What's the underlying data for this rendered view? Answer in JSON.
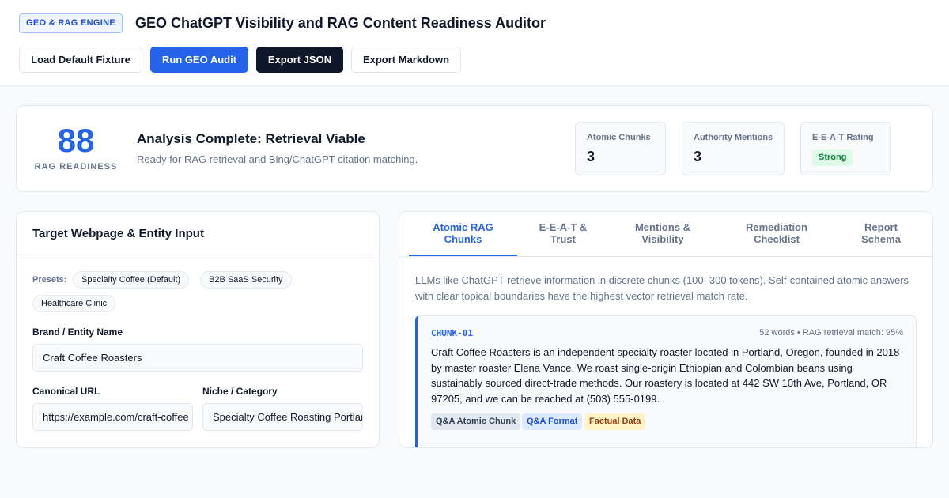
{
  "header": {
    "badge": "GEO & RAG ENGINE",
    "title": "GEO ChatGPT Visibility and RAG Content Readiness Auditor",
    "buttons": {
      "load": "Load Default Fixture",
      "run": "Run GEO Audit",
      "export_json": "Export JSON",
      "export_md": "Export Markdown"
    }
  },
  "summary": {
    "score": "88",
    "score_label": "RAG READINESS",
    "status_title": "Analysis Complete: Retrieval Viable",
    "status_desc": "Ready for RAG retrieval and Bing/ChatGPT citation matching.",
    "metrics": [
      {
        "label": "Atomic Chunks",
        "value": "3"
      },
      {
        "label": "Authority Mentions",
        "value": "3"
      },
      {
        "label": "E-E-A-T Rating",
        "value": "Strong"
      }
    ]
  },
  "input_panel": {
    "title": "Target Webpage & Entity Input",
    "presets_label": "Presets:",
    "presets": [
      "Specialty Coffee (Default)",
      "B2B SaaS Security",
      "Healthcare Clinic"
    ],
    "brand_label": "Brand / Entity Name",
    "brand_value": "Craft Coffee Roasters",
    "url_label": "Canonical URL",
    "url_value": "https://example.com/craft-coffee",
    "niche_label": "Niche / Category",
    "niche_value": "Specialty Coffee Roasting Portland"
  },
  "results_panel": {
    "tabs": [
      {
        "line1": "Atomic RAG",
        "line2": "Chunks"
      },
      {
        "line1": "E-E-A-T &",
        "line2": "Trust"
      },
      {
        "line1": "Mentions &",
        "line2": "Visibility"
      },
      {
        "line1": "Remediation",
        "line2": "Checklist"
      },
      {
        "line1": "Report",
        "line2": "Schema"
      }
    ],
    "intro": "LLMs like ChatGPT retrieve information in discrete chunks (100–300 tokens). Self-contained atomic answers with clear topical boundaries have the highest vector retrieval match rate.",
    "chunk": {
      "id": "CHUNK-01",
      "meta": "52 words • RAG retrieval match: 95%",
      "text": "Craft Coffee Roasters is an independent specialty roaster located in Portland, Oregon, founded in 2018 by master roaster Elena Vance. We roast single-origin Ethiopian and Colombian beans using sustainably sourced direct-trade methods. Our roastery is located at 442 SW 10th Ave, Portland, OR 97205, and we can be reached at (503) 555-0199.",
      "tags": [
        "Q&A Atomic Chunk",
        "Q&A Format",
        "Factual Data"
      ]
    }
  },
  "colors": {
    "accent": "#2563eb",
    "dark": "#0f172a",
    "success": "#15803d"
  }
}
